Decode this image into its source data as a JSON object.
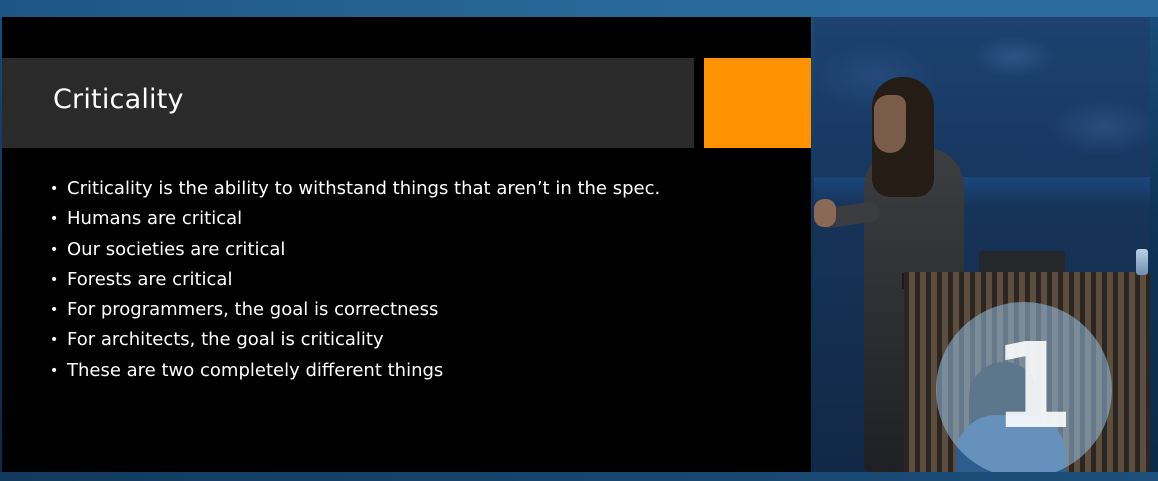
{
  "slide": {
    "title": "Criticality",
    "accent_color": "#ff9200",
    "bullets": [
      "Criticality is the ability to withstand things that aren’t in the spec.",
      "Humans are critical",
      "Our societies are critical",
      "Forests are critical",
      "For programmers, the goal is correctness",
      "For architects, the goal is criticality",
      "These are two completely different things"
    ]
  },
  "logo": {
    "glyph": "1"
  }
}
